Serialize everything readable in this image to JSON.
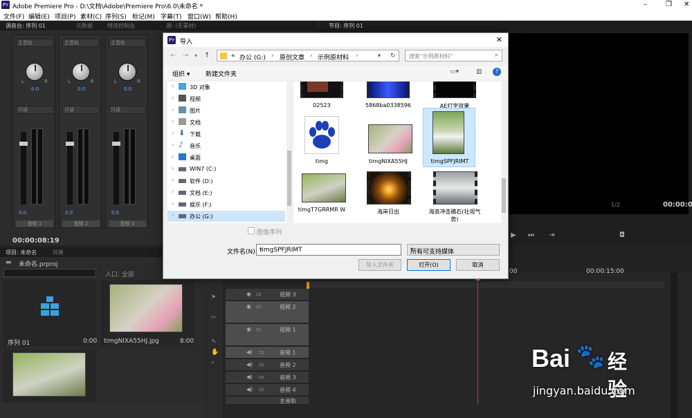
{
  "app": {
    "title": "Adobe Premiere Pro - D:\\文档\\Adobe\\Premiere Pro\\6.0\\未命名 *",
    "logo": "Pr"
  },
  "menu": [
    "文件(F)",
    "编辑(E)",
    "项目(P)",
    "素材(C)",
    "序列(S)",
    "标记(M)",
    "字幕(T)",
    "窗口(W)",
    "帮助(H)"
  ],
  "panels": {
    "top_tabs": [
      "调音台: 序列 01",
      "元数据",
      "特效控制台",
      "源: (无素材)"
    ],
    "program_tab": "节目: 序列 01",
    "mixer": {
      "channels": [
        {
          "sel": "主音轨",
          "knob_val": "0.0",
          "auto": "只读",
          "name": "音频 1"
        },
        {
          "sel": "主音轨",
          "knob_val": "0.0",
          "auto": "只读",
          "name": "音频 2"
        },
        {
          "sel": "主音轨",
          "knob_val": "0.0",
          "auto": "只读",
          "name": "音频 3"
        }
      ],
      "scale": [
        "dB",
        "6",
        "0",
        "-6",
        "-12",
        "-18",
        "-24",
        "-36",
        "dB"
      ],
      "scale_right": [
        "dB",
        "-12",
        "-24",
        "-36",
        "-48",
        "dB"
      ],
      "bottom_val": "0.0",
      "timecode": "00:00:08:19"
    },
    "program": {
      "zoom": "1/2",
      "timecode": "00:00:00"
    },
    "project": {
      "tabs": [
        "项目: 未命名",
        "效果"
      ],
      "file": "未命名.prproj",
      "entry_label": "入口: 全部",
      "items": [
        {
          "name": "序列 01",
          "duration": "0:00"
        },
        {
          "name": "timgNIXA55HJ.jpg",
          "duration": "8:00"
        }
      ]
    },
    "timeline": {
      "time_label": "00:00:15:00",
      "time_label2": "00",
      "tracks": [
        {
          "name": "视频 3"
        },
        {
          "name": "视频 2"
        },
        {
          "name": "视频 1"
        },
        {
          "name": "音频 1"
        },
        {
          "name": "音频 2"
        },
        {
          "name": "音频 3"
        },
        {
          "name": "音频 4"
        },
        {
          "name": "主音轨"
        }
      ]
    }
  },
  "dialog": {
    "title": "导入",
    "breadcrumb": [
      "«",
      "办公 (G:)",
      "›",
      "原创文章",
      "›",
      "示例原材料",
      "›"
    ],
    "search_placeholder": "搜索\"示例原材料\"",
    "organize": "组织 ▾",
    "new_folder": "新建文件夹",
    "tree": [
      {
        "label": "3D 对象",
        "icon": "cube-icon",
        "color": "#4aa3df"
      },
      {
        "label": "视频",
        "icon": "video-folder-icon",
        "color": "#555"
      },
      {
        "label": "图片",
        "icon": "picture-folder-icon",
        "color": "#555"
      },
      {
        "label": "文档",
        "icon": "document-folder-icon",
        "color": "#777"
      },
      {
        "label": "下载",
        "icon": "download-folder-icon",
        "color": "#2a6bd1"
      },
      {
        "label": "音乐",
        "icon": "music-folder-icon",
        "color": "#2a6bd1"
      },
      {
        "label": "桌面",
        "icon": "desktop-folder-icon",
        "color": "#1e7ad4"
      },
      {
        "label": "WIN7 (C:)",
        "icon": "drive-icon",
        "color": "#555"
      },
      {
        "label": "软件 (D:)",
        "icon": "drive-icon",
        "color": "#555"
      },
      {
        "label": "文档 (E:)",
        "icon": "drive-icon",
        "color": "#555"
      },
      {
        "label": "娱乐 (F:)",
        "icon": "drive-icon",
        "color": "#555"
      },
      {
        "label": "办公 (G:)",
        "icon": "drive-icon",
        "color": "#555"
      }
    ],
    "files": [
      {
        "name": "02523",
        "kind": "video"
      },
      {
        "name": "5868ba0338596",
        "kind": "video"
      },
      {
        "name": "AE打字效果",
        "kind": "video"
      },
      {
        "name": "timg",
        "kind": "paw"
      },
      {
        "name": "timgNIXA55HJ",
        "kind": "photo"
      },
      {
        "name": "timgSPFJRIMT",
        "kind": "photo"
      },
      {
        "name": "timgT7GRRMR W",
        "kind": "photo"
      },
      {
        "name": "海岸日出",
        "kind": "video"
      },
      {
        "name": "海浪冲击礁石(壮观气势)",
        "kind": "video"
      }
    ],
    "image_seq": "图像序列",
    "filename_label": "文件名(N):",
    "filename_value": "timgSPFJRIMT",
    "filetype": "所有可支持媒体",
    "import_folder": "导入文件夹",
    "open": "打开(O)",
    "cancel": "取消"
  },
  "watermark": {
    "brand": "Bai",
    "brand2": "经验",
    "url": "jingyan.baidu.com"
  }
}
